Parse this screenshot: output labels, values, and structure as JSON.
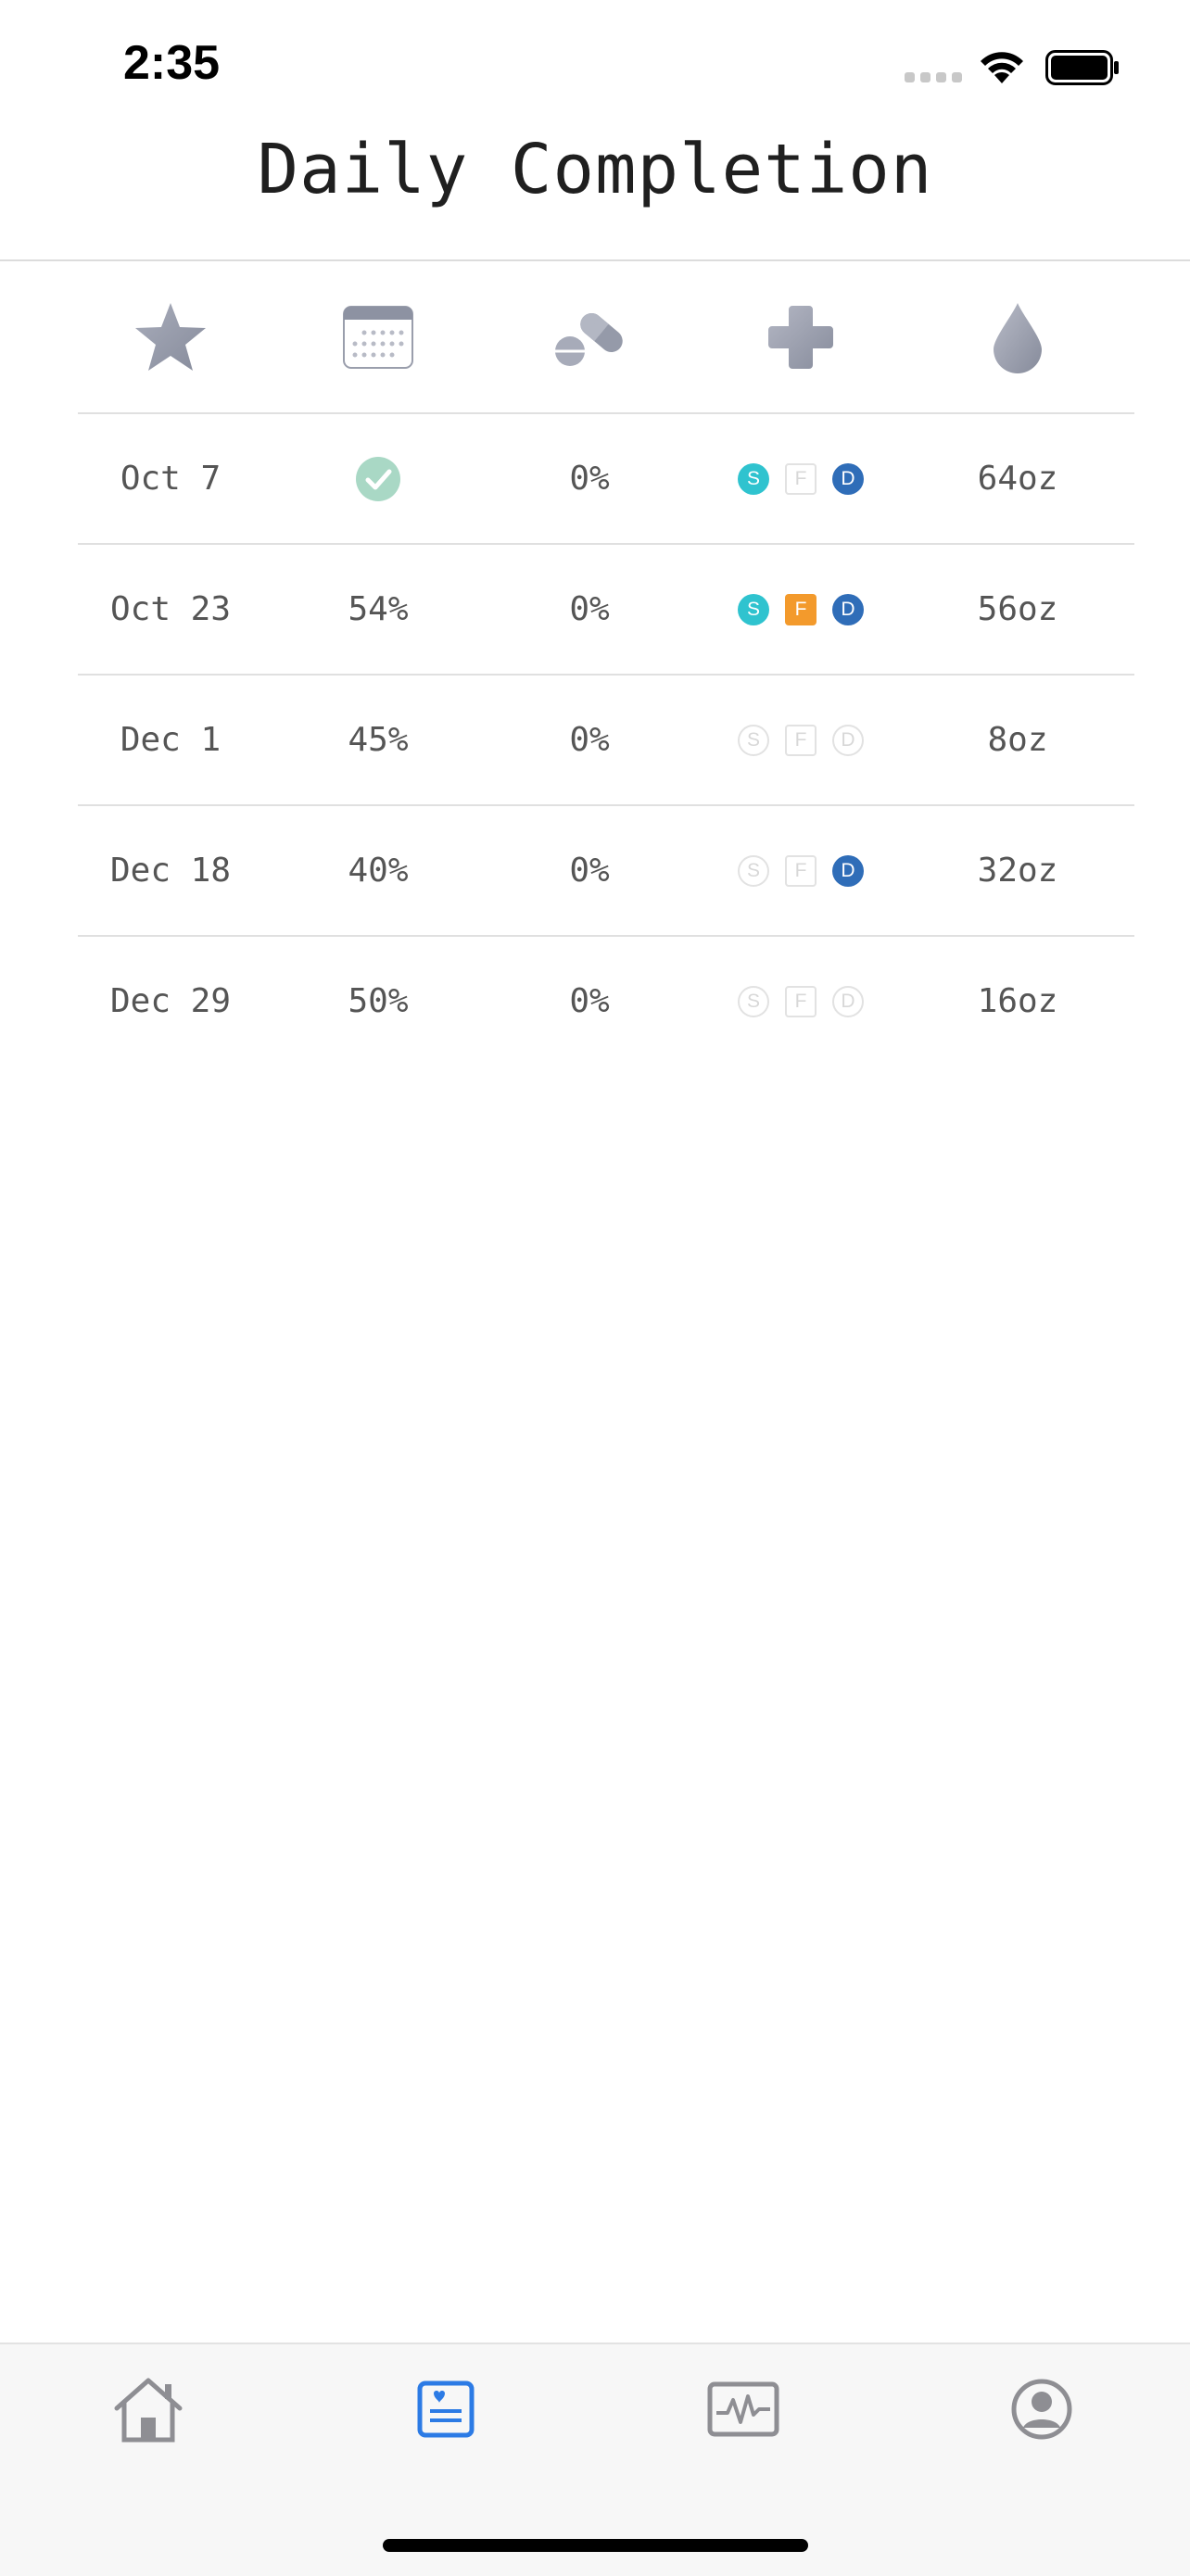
{
  "status_bar": {
    "time": "2:35"
  },
  "header": {
    "title": "Daily Completion"
  },
  "table": {
    "columns": [
      {
        "icon": "star-icon"
      },
      {
        "icon": "calendar-icon"
      },
      {
        "icon": "pill-icon"
      },
      {
        "icon": "medical-cross-icon"
      },
      {
        "icon": "water-drop-icon"
      }
    ],
    "rows": [
      {
        "date": "Oct 7",
        "completion": "",
        "completion_icon": "check-circle-icon",
        "meds": "0%",
        "badges": [
          {
            "letter": "S",
            "active": true,
            "color": "#2fc3cf"
          },
          {
            "letter": "F",
            "active": false,
            "color": "#f39a2c"
          },
          {
            "letter": "D",
            "active": true,
            "color": "#2f6db8"
          }
        ],
        "water": "64oz"
      },
      {
        "date": "Oct 23",
        "completion": "54%",
        "meds": "0%",
        "badges": [
          {
            "letter": "S",
            "active": true,
            "color": "#2fc3cf"
          },
          {
            "letter": "F",
            "active": true,
            "color": "#f39a2c"
          },
          {
            "letter": "D",
            "active": true,
            "color": "#2f6db8"
          }
        ],
        "water": "56oz"
      },
      {
        "date": "Dec 1",
        "completion": "45%",
        "meds": "0%",
        "badges": [
          {
            "letter": "S",
            "active": false,
            "color": "#2fc3cf"
          },
          {
            "letter": "F",
            "active": false,
            "color": "#f39a2c"
          },
          {
            "letter": "D",
            "active": false,
            "color": "#2f6db8"
          }
        ],
        "water": "8oz"
      },
      {
        "date": "Dec 18",
        "completion": "40%",
        "meds": "0%",
        "badges": [
          {
            "letter": "S",
            "active": false,
            "color": "#2fc3cf"
          },
          {
            "letter": "F",
            "active": false,
            "color": "#f39a2c"
          },
          {
            "letter": "D",
            "active": true,
            "color": "#2f6db8"
          }
        ],
        "water": "32oz"
      },
      {
        "date": "Dec 29",
        "completion": "50%",
        "meds": "0%",
        "badges": [
          {
            "letter": "S",
            "active": false,
            "color": "#2fc3cf"
          },
          {
            "letter": "F",
            "active": false,
            "color": "#f39a2c"
          },
          {
            "letter": "D",
            "active": false,
            "color": "#2f6db8"
          }
        ],
        "water": "16oz"
      }
    ]
  },
  "tab_bar": {
    "tabs": [
      {
        "icon": "home-icon",
        "active": false
      },
      {
        "icon": "journal-icon",
        "active": true
      },
      {
        "icon": "activity-icon",
        "active": false
      },
      {
        "icon": "profile-icon",
        "active": false
      }
    ],
    "active_color": "#2c7be5",
    "inactive_color": "#8e8e93"
  }
}
